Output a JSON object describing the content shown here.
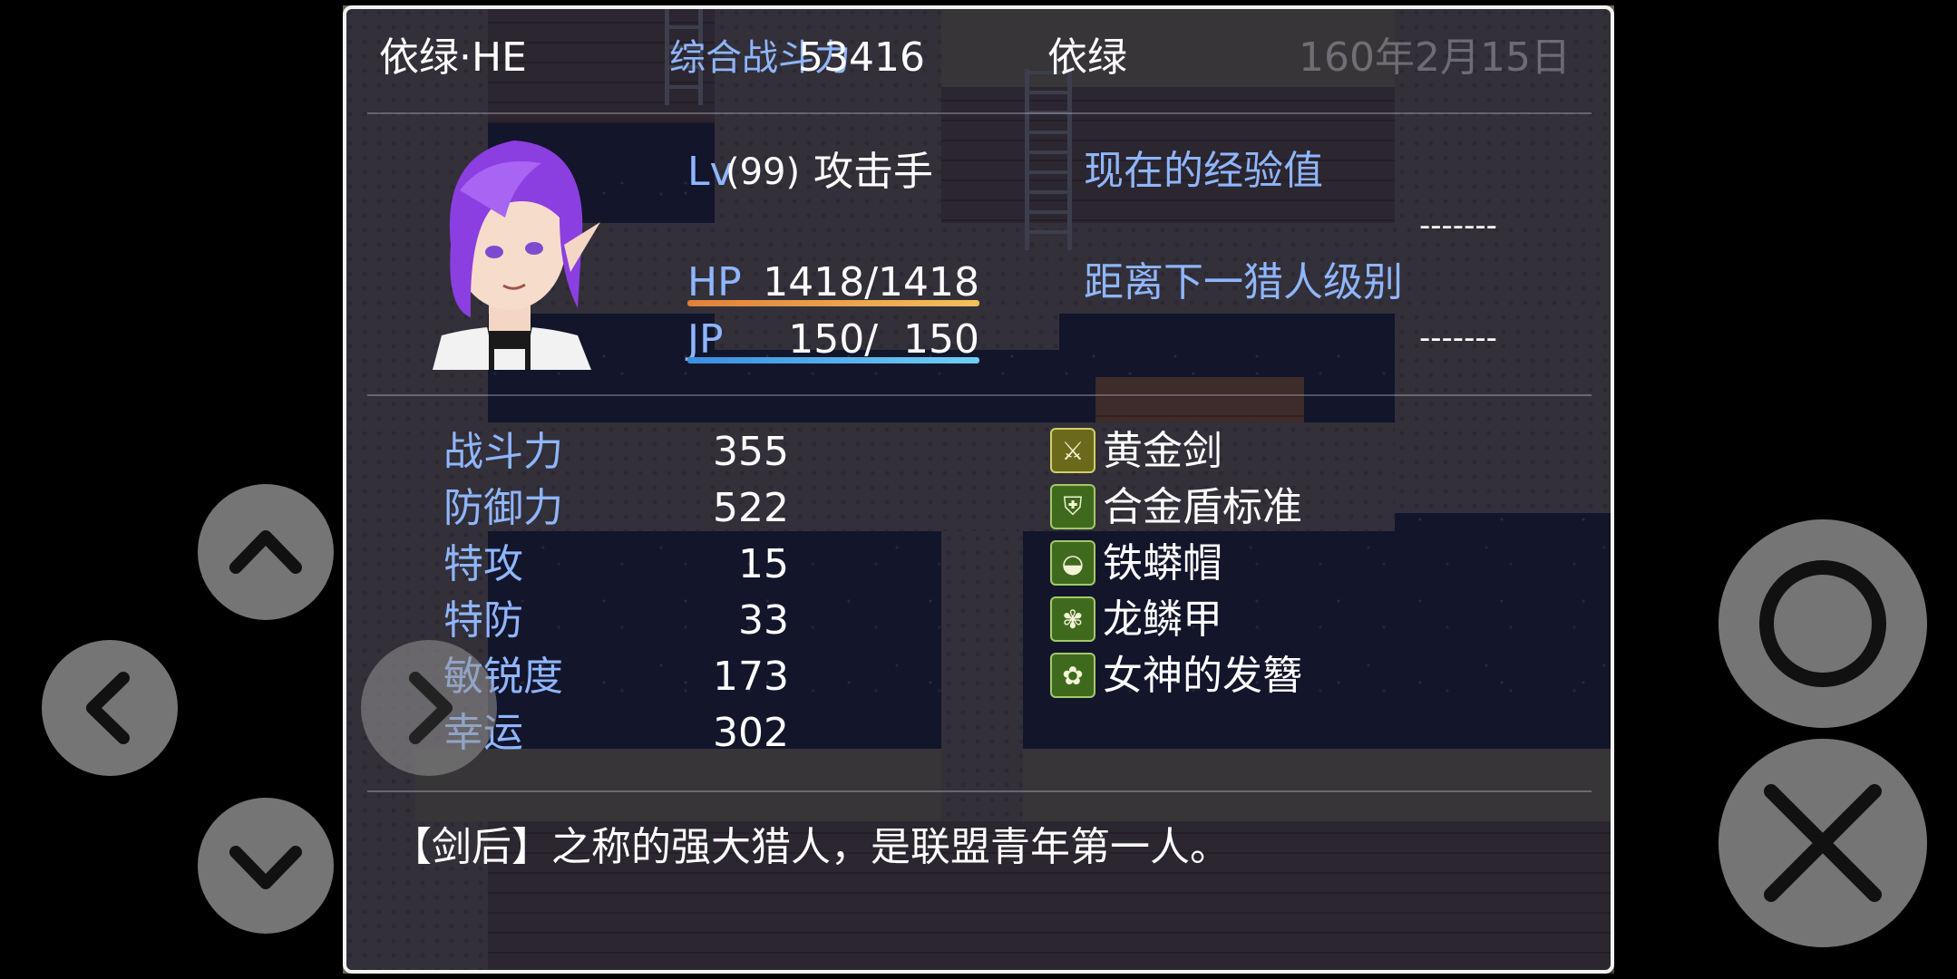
{
  "header": {
    "actor_name": "依绿·HE",
    "power_label": "综合战斗力",
    "power_value": "53416",
    "actor_nickname": "依绿",
    "date": "160年2月15日"
  },
  "status": {
    "level_label": "Lv",
    "level_value": "(99)",
    "class_name": "攻击手",
    "hp_label": "HP",
    "hp_value": "1418/1418",
    "hp_fraction": 1.0,
    "jp_label": "JP",
    "jp_value": "150/  150",
    "jp_fraction": 1.0,
    "exp_current_label": "现在的经验值",
    "exp_current_value": "-------",
    "exp_next_label": "距离下一猎人级别",
    "exp_next_value": "-------"
  },
  "params": [
    {
      "label": "战斗力",
      "value": "355"
    },
    {
      "label": "防御力",
      "value": "522"
    },
    {
      "label": "特攻",
      "value": "15"
    },
    {
      "label": "特防",
      "value": "33"
    },
    {
      "label": "敏锐度",
      "value": "173"
    },
    {
      "label": "幸运",
      "value": "302"
    }
  ],
  "equipment": [
    {
      "name": "黄金剑",
      "icon": "sword-icon",
      "glyph": "⚔"
    },
    {
      "name": "合金盾标准",
      "icon": "shield-icon",
      "glyph": "⛨"
    },
    {
      "name": "铁蟒帽",
      "icon": "hat-icon",
      "glyph": "◒"
    },
    {
      "name": "龙鳞甲",
      "icon": "armor-icon",
      "glyph": "✾"
    },
    {
      "name": "女神的发簪",
      "icon": "hairpin-icon",
      "glyph": "✿"
    }
  ],
  "profile": "【剑后】之称的强大猎人，是联盟青年第一人。",
  "colors": {
    "system_text": "#8fb6ff",
    "hp_gauge": [
      "#e0803a",
      "#f2c15a"
    ],
    "jp_gauge": [
      "#3a8ee0",
      "#6ed0f5"
    ],
    "window_border": "#f2f2f2"
  },
  "controls": {
    "up": "chevron-up-icon",
    "left": "chevron-left-icon",
    "right": "chevron-right-icon",
    "down": "chevron-down-icon",
    "confirm": "circle-icon",
    "cancel": "cross-icon"
  }
}
